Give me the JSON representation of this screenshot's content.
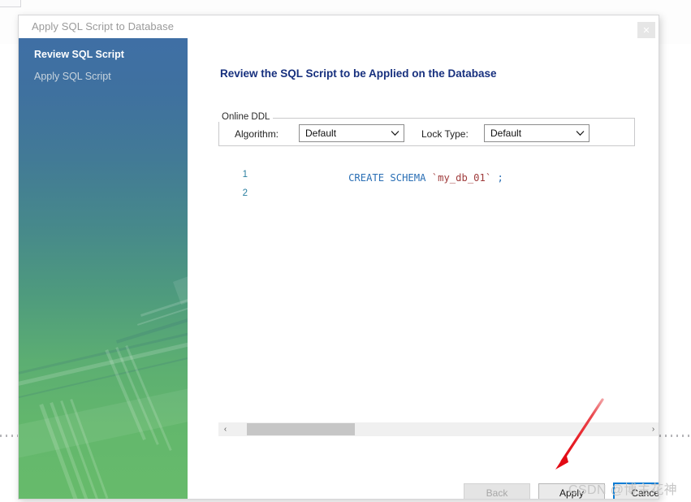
{
  "window": {
    "title": "Apply SQL Script to Database",
    "close_icon": "close-icon",
    "close_glyph": "✕"
  },
  "sidebar": {
    "items": [
      {
        "label": "Review SQL Script",
        "active": true
      },
      {
        "label": "Apply SQL Script",
        "active": false
      }
    ]
  },
  "content": {
    "heading": "Review the SQL Script to be Applied on the Database",
    "online_ddl": {
      "legend": "Online DDL",
      "algorithm": {
        "label": "Algorithm:",
        "value": "Default",
        "chevron": "⌄"
      },
      "lock_type": {
        "label": "Lock Type:",
        "value": "Default",
        "chevron": "⌄"
      }
    },
    "editor": {
      "lines": [
        {
          "number": "1",
          "keyword": "CREATE SCHEMA ",
          "identifier": "`my_db_01`",
          "punctuation": " ;"
        },
        {
          "number": "2",
          "keyword": "",
          "identifier": "",
          "punctuation": ""
        }
      ]
    },
    "scrollbar": {
      "left_arrow": "‹",
      "right_arrow": "›"
    }
  },
  "footer": {
    "back_label": "Back",
    "apply_label": "Apply",
    "cancel_label": "Cancel"
  },
  "annotation": {
    "arrow_color": "#e8252c",
    "watermark": "CSDN @博主花神"
  },
  "colors": {
    "sidebar_top": "#3f6fa5",
    "sidebar_bottom": "#67bb6b",
    "heading": "#17307e",
    "nav_active_bg": "#3f6fa5",
    "focus_border": "#0a7cd4",
    "sql_keyword": "#2a6fb5",
    "sql_identifier": "#a03c3c",
    "line_number": "#2a7fa0"
  }
}
